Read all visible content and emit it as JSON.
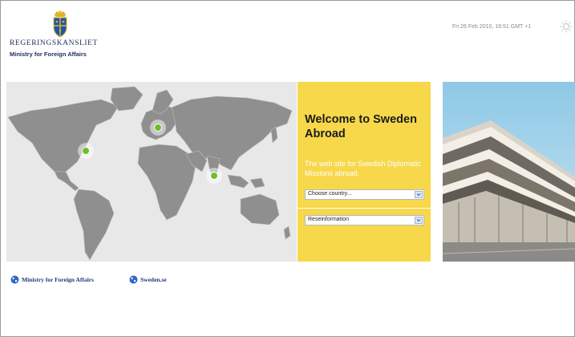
{
  "header": {
    "brand": "REGERINGSKANSLIET",
    "subtitle": "Ministry for Foreign Affairs",
    "datetime": "Fri 26 Feb 2010, 16:51 GMT +1",
    "weather_icon": "sun-icon",
    "crest_icon": "royal-crest-icon"
  },
  "welcome": {
    "title": "Welcome to Sweden Abroad",
    "tagline": "The web site for Swedish Diplomatic Missions abroad.",
    "country_select": {
      "value": "Choose country..."
    },
    "info_select": {
      "value": "Reseinformation"
    }
  },
  "links": [
    {
      "label": "Ministry for Foreign Affairs",
      "icon": "globe-icon"
    },
    {
      "label": "Sweden.se",
      "icon": "globe-icon"
    }
  ],
  "colors": {
    "accent_yellow": "#f7d84a",
    "map_land": "#8f8f8f",
    "map_bg": "#e8e8e8",
    "marker_green": "#6dbe2c",
    "link_blue": "#1f3b7a"
  }
}
